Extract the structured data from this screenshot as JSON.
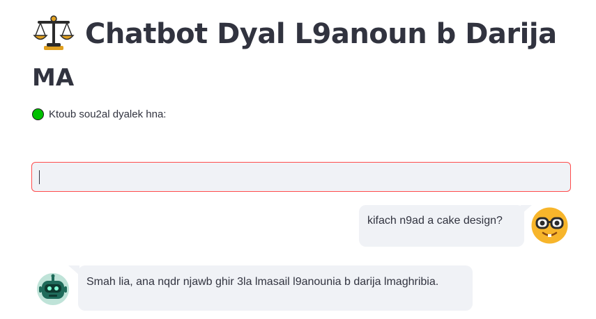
{
  "header": {
    "title_line1": "Chatbot Dyal L9anoun b Darija",
    "title_line2": "MA",
    "title_icon": "balance-scale-icon"
  },
  "prompt": {
    "label": "Ktoub sou2al dyalek hna:",
    "indicator_icon": "green-circle-icon",
    "input_value": ""
  },
  "chat": {
    "messages": [
      {
        "role": "user",
        "avatar_icon": "nerd-face-icon",
        "text": "kifach n9ad a cake design?"
      },
      {
        "role": "bot",
        "avatar_icon": "robot-icon",
        "text": "Smah lia, ana nqdr njawb ghir 3la lmasail l9anounia b darija lmaghribia."
      }
    ]
  },
  "colors": {
    "text": "#31333f",
    "bubble": "#f0f2f6",
    "input_border": "#ff4b4b",
    "indicator": "#00c000",
    "user_avatar": "#f7b52b",
    "bot_avatar": "#1f6b5a"
  }
}
